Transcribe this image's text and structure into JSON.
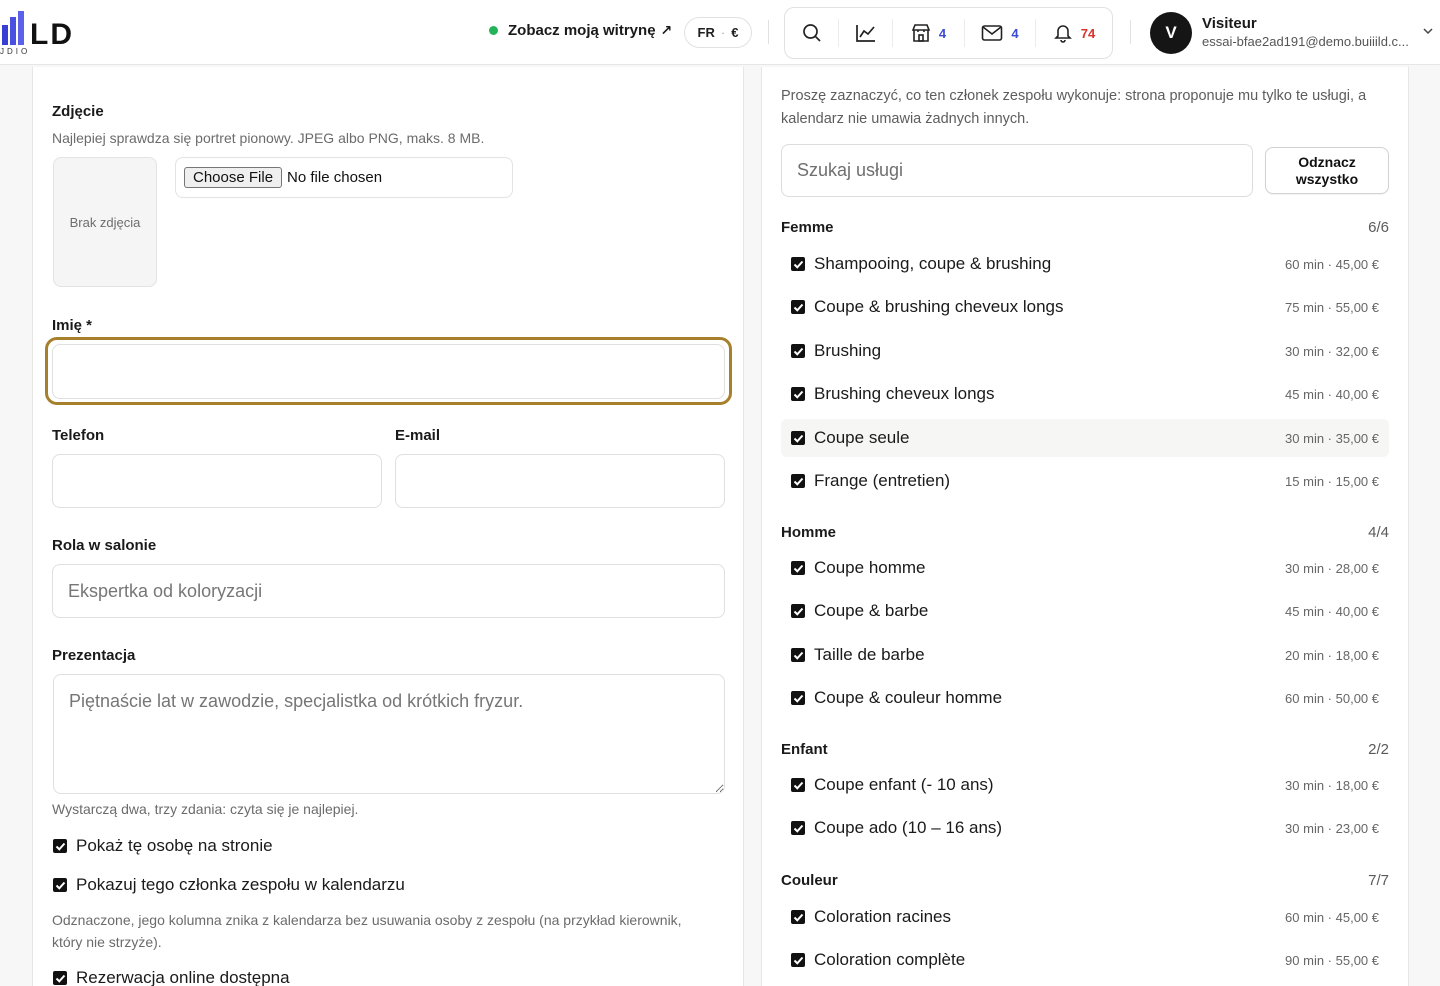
{
  "header": {
    "logo_text": "LD",
    "logo_sub": "JDIO",
    "site_link": "Zobacz moją witrynę",
    "lang": "FR",
    "currency": "€",
    "tools": [
      {
        "icon": "search-icon",
        "count": ""
      },
      {
        "icon": "chart-icon",
        "count": ""
      },
      {
        "icon": "store-icon",
        "count": "4"
      },
      {
        "icon": "mail-icon",
        "count": "4"
      },
      {
        "icon": "bell-icon",
        "count": "74"
      }
    ],
    "user": {
      "initial": "V",
      "name": "Visiteur",
      "email": "essai-bfae2ad191@demo.buiiild.c..."
    }
  },
  "form": {
    "photo_label": "Zdjęcie",
    "photo_hint": "Najlepiej sprawdza się portret pionowy. JPEG albo PNG, maks. 8 MB.",
    "no_photo": "Brak zdjęcia",
    "choose_file": "Choose File",
    "no_file": "No file chosen",
    "name_label": "Imię *",
    "name_value": "",
    "phone_label": "Telefon",
    "email_label": "E-mail",
    "role_label": "Rola w salonie",
    "role_placeholder": "Ekspertka od koloryzacji",
    "bio_label": "Prezentacja",
    "bio_placeholder": "Piętnaście lat w zawodzie, specjalistka od krótkich fryzur.",
    "bio_hint": "Wystarczą dwa, trzy zdania: czyta się je najlepiej.",
    "show_on_site": "Pokaż tę osobę na stronie",
    "show_in_calendar": "Pokazuj tego członka zespołu w kalendarzu",
    "calendar_hint": "Odznaczone, jego kolumna znika z kalendarza bez usuwania osoby z zespołu (na przykład kierownik, który nie strzyże).",
    "online_booking": "Rezerwacja online dostępna"
  },
  "services": {
    "intro": "Proszę zaznaczyć, co ten członek zespołu wykonuje: strona proponuje mu tylko te usługi, a kalendarz nie umawia żadnych innych.",
    "search_placeholder": "Szukaj usługi",
    "unselect_all": "Odznacz wszystko",
    "groups": [
      {
        "name": "Femme",
        "count": "6/6",
        "items": [
          {
            "name": "Shampooing, coupe & brushing",
            "meta": "60 min · 45,00 €"
          },
          {
            "name": "Coupe & brushing cheveux longs",
            "meta": "75 min · 55,00 €"
          },
          {
            "name": "Brushing",
            "meta": "30 min · 32,00 €"
          },
          {
            "name": "Brushing cheveux longs",
            "meta": "45 min · 40,00 €"
          },
          {
            "name": "Coupe seule",
            "meta": "30 min · 35,00 €"
          },
          {
            "name": "Frange (entretien)",
            "meta": "15 min · 15,00 €"
          }
        ]
      },
      {
        "name": "Homme",
        "count": "4/4",
        "items": [
          {
            "name": "Coupe homme",
            "meta": "30 min · 28,00 €"
          },
          {
            "name": "Coupe & barbe",
            "meta": "45 min · 40,00 €"
          },
          {
            "name": "Taille de barbe",
            "meta": "20 min · 18,00 €"
          },
          {
            "name": "Coupe & couleur homme",
            "meta": "60 min · 50,00 €"
          }
        ]
      },
      {
        "name": "Enfant",
        "count": "2/2",
        "items": [
          {
            "name": "Coupe enfant (- 10 ans)",
            "meta": "30 min · 18,00 €"
          },
          {
            "name": "Coupe ado (10 – 16 ans)",
            "meta": "30 min · 23,00 €"
          }
        ]
      },
      {
        "name": "Couleur",
        "count": "7/7",
        "items": [
          {
            "name": "Coloration racines",
            "meta": "60 min · 45,00 €"
          },
          {
            "name": "Coloration complète",
            "meta": "90 min · 55,00 €"
          }
        ]
      }
    ]
  },
  "colors": {
    "focus": "#a6802d",
    "badge_blue": "#3b4bd6",
    "badge_red": "#d9342b",
    "online_dot": "#23b45a"
  }
}
